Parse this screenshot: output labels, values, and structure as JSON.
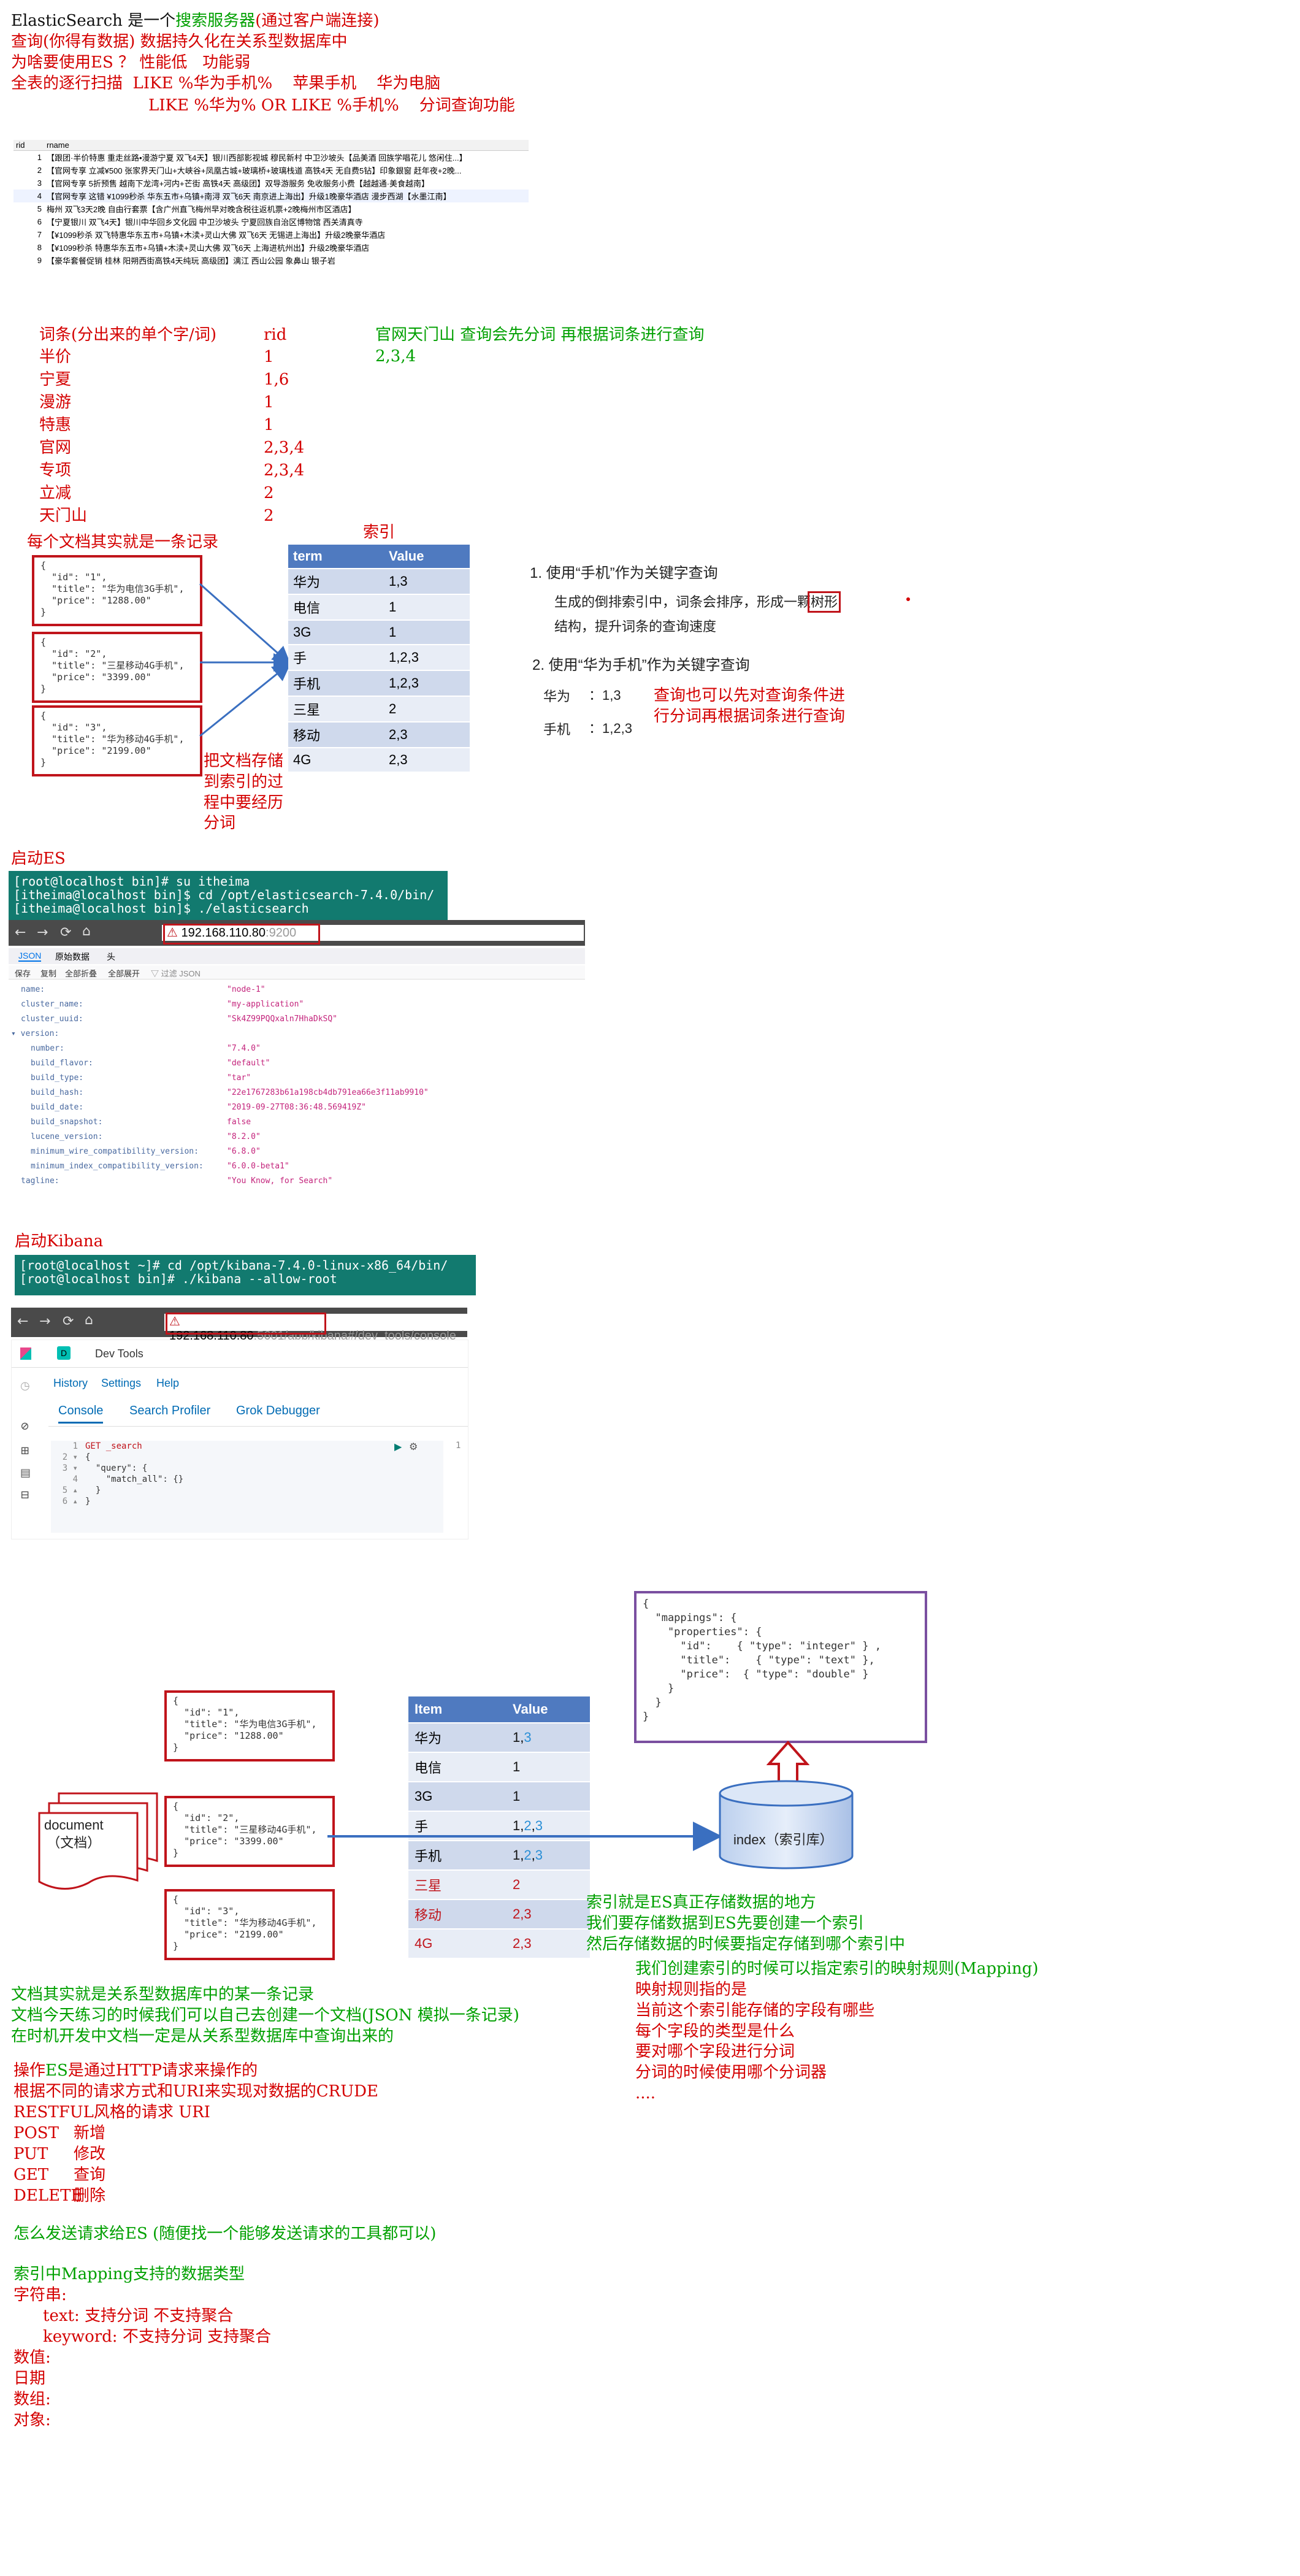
{
  "intro": {
    "title_prefix": "ElasticSearch 是一个",
    "title_link": "搜索服务器",
    "title_suffix": "(通过客户端连接)",
    "line2": "查询(你得有数据) 数据持久化在关系型数据库中",
    "line3": "为啥要使用ES ？ 性能低   功能弱",
    "line4": "全表的逐行扫描  LIKE %华为手机%    苹果手机    华为电脑",
    "line5": "LIKE %华为% OR LIKE %手机%    分词查询功能"
  },
  "db_table": {
    "headers": [
      "rid",
      "rname"
    ],
    "rows": [
      [
        "1",
        "【跟团·半价特惠 重走丝路•漫游宁夏 双飞4天】银川西部影视城 穆民新村 中卫沙坡头【品美酒 回族学唱花儿 悠闲住...】"
      ],
      [
        "2",
        "【官网专享 立减¥500 张家界天门山+大峡谷+凤凰古城+玻璃桥+玻璃栈道 高铁4天 无自费5钻】印象銀窗 赶年夜+2晚..."
      ],
      [
        "3",
        "【官网专享 5折预售 越南下龙湾+河内+芒街 高铁4天 高级团】双导游服务 免收服务小费【越越通·美食越南】"
      ],
      [
        "4",
        "【官网专享 这错 ¥1099秒杀 华东五市+乌镇+南浔 双飞6天 南京进上海出】升级1晚豪华酒店 漫步西湖【水墨江南】"
      ],
      [
        "5",
        "梅州 双飞3天2晚 自由行套票【含广州直飞梅州早对晚含税往返机票+2晚梅州市区酒店】"
      ],
      [
        "6",
        "【宁夏银川 双飞4天】银川中华回乡文化园 中卫沙坡头 宁夏回族自治区博物馆 西关清真寺"
      ],
      [
        "7",
        "【¥1099秒杀 双飞特惠华东五市+乌镇+木渎+灵山大佛 双飞6天 无锡进上海出】升级2晚豪华酒店"
      ],
      [
        "8",
        "【¥1099秒杀 特惠华东五市+乌镇+木渎+灵山大佛 双飞6天 上海进杭州出】升级2晚豪华酒店"
      ],
      [
        "9",
        "【豪华套餐促销 桂林 阳朔西街高铁4天纯玩 高级团】漓江 西山公园 象鼻山 银子岩"
      ]
    ]
  },
  "terms": {
    "col1_header": "词条(分出来的单个字/词)",
    "col2_header": "rid",
    "rows": [
      [
        "半价",
        "1"
      ],
      [
        "宁夏",
        "1,6"
      ],
      [
        "漫游",
        "1"
      ],
      [
        "特惠",
        "1"
      ],
      [
        "官网",
        "2,3,4"
      ],
      [
        "专项",
        "2,3,4"
      ],
      [
        "立减",
        "2"
      ],
      [
        "天门山",
        "2"
      ]
    ],
    "note1": "官网天门山 查询会先分词 再根据词条进行查询",
    "note2": "2,3,4"
  },
  "index_demo": {
    "doc_label": "每个文档其实就是一条记录",
    "index_label": "索引",
    "docs": [
      [
        "\"id\": \"1\",",
        "\"title\": \"华为电信3G手机\",",
        "\"price\": \"1288.00\""
      ],
      [
        "\"id\": \"2\",",
        "\"title\": \"三星移动4G手机\",",
        "\"price\": \"3399.00\""
      ],
      [
        "\"id\": \"3\",",
        "\"title\": \"华为移动4G手机\",",
        "\"price\": \"2199.00\""
      ]
    ],
    "table_headers": [
      "term",
      "Value"
    ],
    "table_rows": [
      [
        "华为",
        "1,3"
      ],
      [
        "电信",
        "1"
      ],
      [
        "3G",
        "1"
      ],
      [
        "手",
        "1,2,3"
      ],
      [
        "手机",
        "1,2,3"
      ],
      [
        "三星",
        "2"
      ],
      [
        "移动",
        "2,3"
      ],
      [
        "4G",
        "2,3"
      ]
    ],
    "store_note": "把文档存储\n到索引的过\n程中要经历\n分词",
    "q1_title": "1. 使用“手机”作为关键字查询",
    "q1_desc_a": "生成的倒排索引中，词条会排序，形成一颗",
    "q1_desc_b": "树形",
    "q1_desc_c": "结构，提升词条的查询速度",
    "q2_title": "2. 使用“华为手机”作为关键字查询",
    "q2_row1_term": "华为",
    "q2_row1_val": "：1,3",
    "q2_row2_term": "手机",
    "q2_row2_val": "：1,2,3",
    "q2_note": "查询也可以先对查询条件进\n行分词再根据词条进行查询"
  },
  "start_es": {
    "label": "启动ES",
    "terminal": "[root@localhost bin]# su itheima\n[itheima@localhost bin]$ cd /opt/elasticsearch-7.4.0/bin/\n[itheima@localhost bin]$ ./elasticsearch",
    "url_host": "192.168.110.80",
    "url_port": ":9200",
    "tabs": [
      "JSON",
      "原始数据",
      "头"
    ],
    "toolbar": [
      "保存",
      "复制",
      "全部折叠",
      "全部展开",
      "过滤 JSON"
    ],
    "fields": [
      [
        "name:",
        "\"node-1\""
      ],
      [
        "cluster_name:",
        "\"my-application\""
      ],
      [
        "cluster_uuid:",
        "\"Sk4Z99PQQxaln7HhaDkSQ\""
      ],
      [
        "▾ version:",
        ""
      ],
      [
        "number:",
        "\"7.4.0\""
      ],
      [
        "build_flavor:",
        "\"default\""
      ],
      [
        "build_type:",
        "\"tar\""
      ],
      [
        "build_hash:",
        "\"22e1767283b61a198cb4db791ea66e3f11ab9910\""
      ],
      [
        "build_date:",
        "\"2019-09-27T08:36:48.569419Z\""
      ],
      [
        "build_snapshot:",
        "false"
      ],
      [
        "lucene_version:",
        "\"8.2.0\""
      ],
      [
        "minimum_wire_compatibility_version:",
        "\"6.8.0\""
      ],
      [
        "minimum_index_compatibility_version:",
        "\"6.0.0-beta1\""
      ],
      [
        "tagline:",
        "\"You Know, for Search\""
      ]
    ]
  },
  "start_kibana": {
    "label": "启动Kibana",
    "terminal": "[root@localhost ~]# cd /opt/kibana-7.4.0-linux-x86_64/bin/\n[root@localhost bin]# ./kibana --allow-root",
    "url_host": "192.168.110.80",
    "url_port": ":5601",
    "url_path": "/app/kibana#/dev_tools/console",
    "space_badge": "D",
    "app_title": "Dev Tools",
    "menu": [
      "History",
      "Settings",
      "Help"
    ],
    "tabs": [
      "Console",
      "Search Profiler",
      "Grok Debugger"
    ],
    "code_lines": [
      "GET _search",
      "{",
      "  \"query\": {",
      "    \"match_all\": {}",
      "  }",
      "}"
    ],
    "line_numbers": [
      "1",
      "2 ▾",
      "3 ▾",
      "4",
      "5 ▴",
      "6 ▴"
    ],
    "output_line": "1"
  },
  "diagram": {
    "doc_label": "document\n（文档）",
    "docs": [
      [
        "\"id\": \"1\",",
        "\"title\": \"华为电信3G手机\",",
        "\"price\": \"1288.00\""
      ],
      [
        "\"id\": \"2\",",
        "\"title\": \"三星移动4G手机\",",
        "\"price\": \"3399.00\""
      ],
      [
        "\"id\": \"3\",",
        "\"title\": \"华为移动4G手机\",",
        "\"price\": \"2199.00\""
      ]
    ],
    "table_headers": [
      "Item",
      "Value"
    ],
    "table_rows": [
      [
        "华为",
        "1,3"
      ],
      [
        "电信",
        "1"
      ],
      [
        "3G",
        "1"
      ],
      [
        "手",
        "1,2,3"
      ],
      [
        "手机",
        "1,2,3"
      ],
      [
        "三星",
        "2"
      ],
      [
        "移动",
        "2,3"
      ],
      [
        "4G",
        "2,3"
      ]
    ],
    "index_label": "index（索引库）",
    "mapping": "{\n  \"mappings\": {\n    \"properties\": {\n      \"id\":    { \"type\": \"integer\" } ,\n      \"title\":    { \"type\": \"text\" },\n      \"price\":  { \"type\": \"double\" }\n    }\n  }\n}",
    "index_note": "索引就是ES真正存储数据的地方\n我们要存储数据到ES先要创建一个索引\n然后存储数据的时候要指定存储到哪个索引中",
    "mapping_note_green": "我们创建索引的时候可以指定索引的映射规则(Mapping)",
    "mapping_note_red": "映射规则指的是\n当前这个索引能存储的字段有哪些\n每个字段的类型是什么\n要对哪个字段进行分词\n分词的时候使用哪个分词器\n....",
    "doc_note": "文档其实就是关系型数据库中的某一条记录\n文档今天练习的时候我们可以自己去创建一个文档(JSON 模拟一条记录)\n在时机开发中文档一定是从关系型数据库中查询出来的"
  },
  "http": {
    "line1_prefix": "操作",
    "line1_es": "ES",
    "line1_suffix": "是通过HTTP请求来操作的",
    "line2": "根据不同的请求方式和URI来实现对数据的CRUDE",
    "line3": "RESTFUL风格的请求 URI",
    "methods": [
      [
        "POST",
        "新增"
      ],
      [
        "PUT",
        "修改"
      ],
      [
        "GET",
        "查询"
      ],
      [
        "DELETE",
        "删除"
      ]
    ],
    "send_note": "怎么发送请求给ES (随便找一个能够发送请求的工具都可以)"
  },
  "types": {
    "title": "索引中Mapping支持的数据类型",
    "string_label": "字符串:",
    "text_line": "text: 支持分词 不支持聚合",
    "keyword_line": "keyword: 不支持分词 支持聚合",
    "others": [
      "数值:",
      "日期",
      "数组:",
      "对象:"
    ]
  }
}
